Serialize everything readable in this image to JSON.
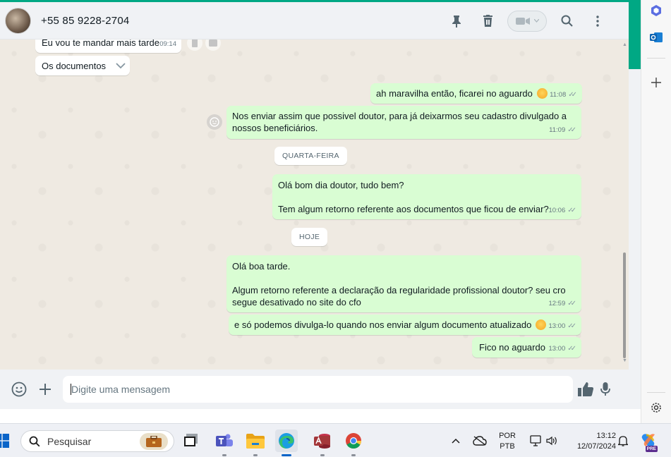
{
  "header": {
    "contact_name": "+55 85 9228-2704"
  },
  "messages": {
    "m1": {
      "text": "Eu vou te mandar mais tarde",
      "time": "09:14"
    },
    "m2": {
      "text": "Os documentos"
    },
    "m3": {
      "text": "ah maravilha então, ficarei no aguardo",
      "time": "11:08"
    },
    "m4": {
      "line1": "Nos enviar assim que possivel doutor, para já deixarmos seu cadastro divulgado a",
      "line2": "nossos beneficiários.",
      "time": "11:09"
    },
    "sys1": "QUARTA-FEIRA",
    "m5": {
      "line1": "Olá bom dia doutor, tudo bem?",
      "line2": "Tem algum retorno referente aos documentos que ficou de enviar?",
      "time": "10:06"
    },
    "sys2": "HOJE",
    "m6": {
      "line1": "Olá boa tarde.",
      "line2": "Algum retorno referente a declaração da regularidade profissional doutor? seu cro",
      "line3": "segue desativado no site do cfo",
      "time": "12:59"
    },
    "m7": {
      "text": "e só podemos divulga-lo quando nos enviar algum documento atualizado",
      "time": "13:00"
    },
    "m8": {
      "text": "Fico no aguardo",
      "time": "13:00"
    }
  },
  "composer": {
    "placeholder": "Digite uma mensagem"
  },
  "taskbar": {
    "search_label": "Pesquisar",
    "lang_top": "POR",
    "lang_bottom": "PTB",
    "time": "13:12",
    "date": "12/07/2024",
    "copilot_badge": "PRE"
  },
  "colors": {
    "outgoing_bubble": "#d9fdd3",
    "incoming_bubble": "#ffffff",
    "accent": "#00a884",
    "chat_background": "#efeae2"
  }
}
